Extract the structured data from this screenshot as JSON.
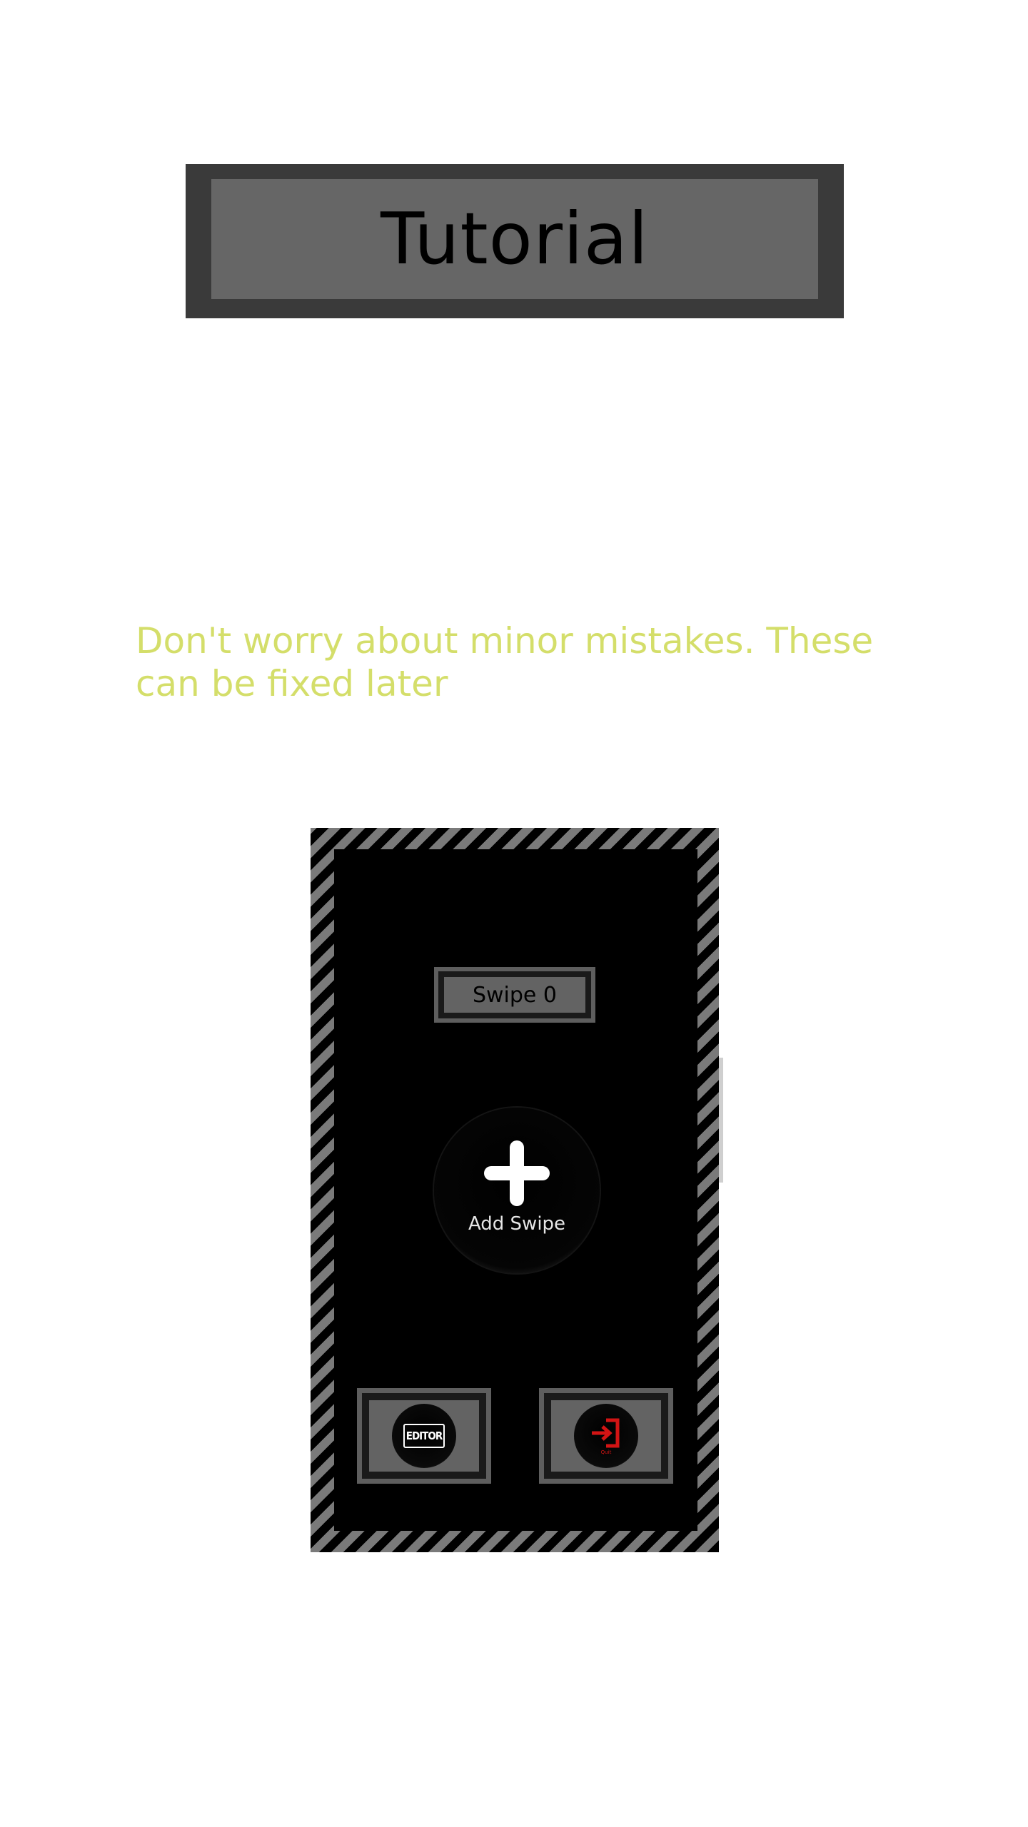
{
  "header": {
    "title": "Tutorial"
  },
  "hint": {
    "text": "Don't worry about minor mistakes. These can be fixed later"
  },
  "preview": {
    "swipe_counter_label": "Swipe 0",
    "add_swipe_label": "Add Swipe",
    "editor_button_label": "EDITOR",
    "quit_button_caption": "Quit"
  },
  "colors": {
    "hint_text": "#d4de6a",
    "banner_outer": "#3a3a3a",
    "banner_inner": "#666666",
    "quit_icon": "#d21414"
  },
  "icons": {
    "add": "plus-icon",
    "editor": "editor-icon",
    "quit": "exit-icon"
  }
}
